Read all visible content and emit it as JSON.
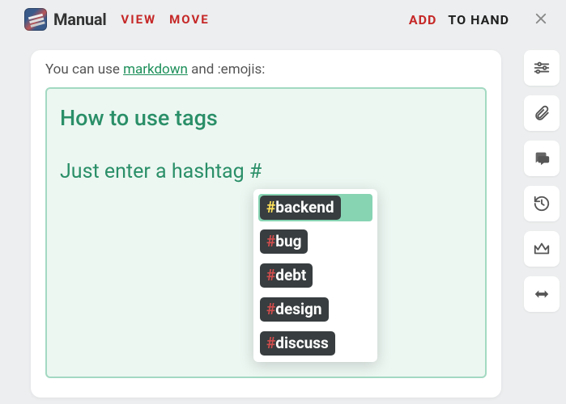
{
  "header": {
    "title": "Manual",
    "nav": {
      "view": "VIEW",
      "move": "MOVE"
    },
    "add": "ADD",
    "to_hand": "TO HAND"
  },
  "panel": {
    "hint_pre": "You can use ",
    "hint_link": "markdown",
    "hint_post": " and :emojis:"
  },
  "editor": {
    "heading": "How to use tags",
    "line": "Just enter a hashtag #"
  },
  "suggestions": [
    {
      "label": "backend",
      "highlighted": true
    },
    {
      "label": "bug",
      "highlighted": false
    },
    {
      "label": "debt",
      "highlighted": false
    },
    {
      "label": "design",
      "highlighted": false
    },
    {
      "label": "discuss",
      "highlighted": false
    }
  ],
  "sidebar_icons": [
    "sliders",
    "paperclip",
    "comments",
    "history",
    "crown",
    "resize-h"
  ]
}
